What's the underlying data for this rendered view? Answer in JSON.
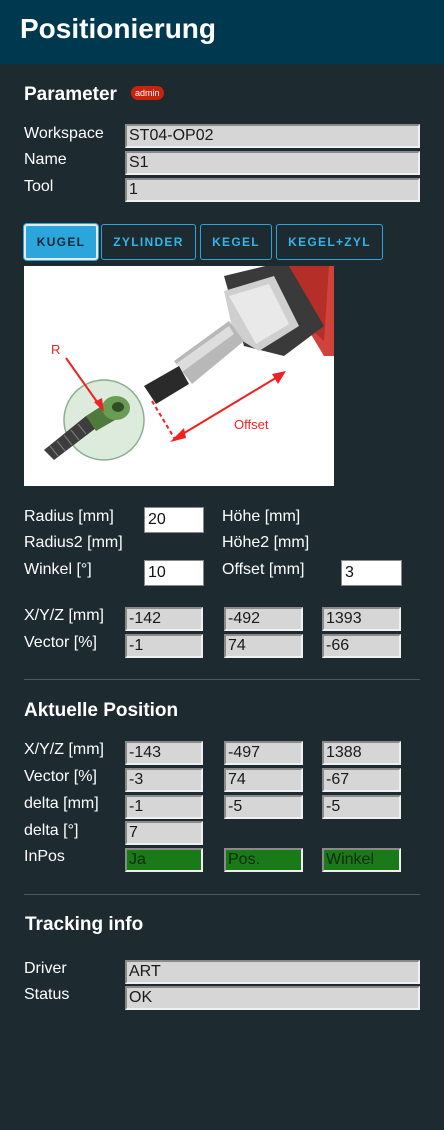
{
  "header": {
    "title": "Positionierung"
  },
  "parameter": {
    "title": "Parameter",
    "badge": "admin",
    "workspace_label": "Workspace",
    "workspace_value": "ST04-OP02",
    "name_label": "Name",
    "name_value": "S1",
    "tool_label": "Tool",
    "tool_value": "1"
  },
  "tabs": [
    {
      "label": "KUGEL",
      "active": true
    },
    {
      "label": "ZYLINDER",
      "active": false
    },
    {
      "label": "KEGEL",
      "active": false
    },
    {
      "label": "KEGEL+ZYL",
      "active": false
    }
  ],
  "illustration": {
    "label_r": "R",
    "label_offset": "Offset"
  },
  "geometry": {
    "radius_label": "Radius [mm]",
    "radius_value": "20",
    "radius2_label": "Radius2 [mm]",
    "winkel_label": "Winkel [°]",
    "winkel_value": "10",
    "hoehe_label": "Höhe [mm]",
    "hoehe2_label": "Höhe2 [mm]",
    "offset_label": "Offset [mm]",
    "offset_value": "3"
  },
  "target": {
    "xyz_label": "X/Y/Z [mm]",
    "xyz_values": [
      "-142",
      "-492",
      "1393"
    ],
    "vector_label": "Vector [%]",
    "vector_values": [
      "-1",
      "74",
      "-66"
    ]
  },
  "current": {
    "title": "Aktuelle Position",
    "xyz_label": "X/Y/Z [mm]",
    "xyz_values": [
      "-143",
      "-497",
      "1388"
    ],
    "vector_label": "Vector [%]",
    "vector_values": [
      "-3",
      "74",
      "-67"
    ],
    "delta_mm_label": "delta [mm]",
    "delta_mm_values": [
      "-1",
      "-5",
      "-5"
    ],
    "delta_deg_label": "delta [°]",
    "delta_deg_value": "7",
    "inpos_label": "InPos",
    "inpos_values": [
      "Ja",
      "Pos.",
      "Winkel"
    ],
    "inpos_color": "#1a7a18"
  },
  "tracking": {
    "title": "Tracking info",
    "driver_label": "Driver",
    "driver_value": "ART",
    "status_label": "Status",
    "status_value": "OK"
  },
  "colors": {
    "background": "#1d2a30",
    "header": "#00394f",
    "accent": "#2aa6dd",
    "badge": "#c8230d"
  }
}
